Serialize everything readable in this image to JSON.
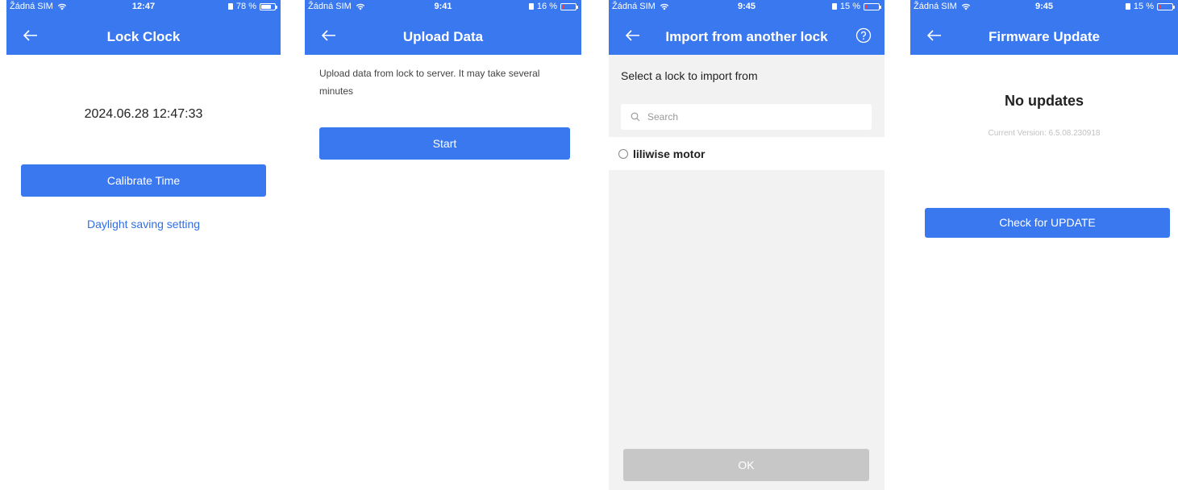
{
  "screens": [
    {
      "status": {
        "carrier": "Žádná SIM",
        "time": "12:47",
        "battery_text": "78 %",
        "battery_level": 0.78,
        "battery_low": false
      },
      "title": "Lock Clock",
      "clock_value": "2024.06.28 12:47:33",
      "calibrate_label": "Calibrate Time",
      "dst_link": "Daylight saving setting"
    },
    {
      "status": {
        "carrier": "Žádná SIM",
        "time": "9:41",
        "battery_text": "16 %",
        "battery_level": 0.16,
        "battery_low": true
      },
      "title": "Upload Data",
      "description": "Upload data from lock to server. It may take several minutes",
      "start_label": "Start"
    },
    {
      "status": {
        "carrier": "Žádná SIM",
        "time": "9:45",
        "battery_text": "15 %",
        "battery_level": 0.15,
        "battery_low": true
      },
      "title": "Import from another lock",
      "select_label": "Select a lock to import from",
      "search_placeholder": "Search",
      "locks": [
        {
          "name": "liliwise motor",
          "selected": false
        }
      ],
      "ok_label": "OK"
    },
    {
      "status": {
        "carrier": "Žádná SIM",
        "time": "9:45",
        "battery_text": "15 %",
        "battery_level": 0.15,
        "battery_low": true
      },
      "title": "Firmware Update",
      "status_title": "No updates",
      "current_version": "Current Version: 6.5.08.230918",
      "check_label": "Check for UPDATE"
    }
  ],
  "colors": {
    "accent": "#3a78f0",
    "link": "#2f6fe6",
    "disabled": "#c7c7c7",
    "battery_low": "#ff3b30",
    "list_bg": "#f2f2f2"
  },
  "icons": {
    "back": "arrow-left-icon",
    "help": "question-circle-icon",
    "search": "search-icon",
    "wifi": "wifi-icon",
    "battery": "battery-icon"
  }
}
